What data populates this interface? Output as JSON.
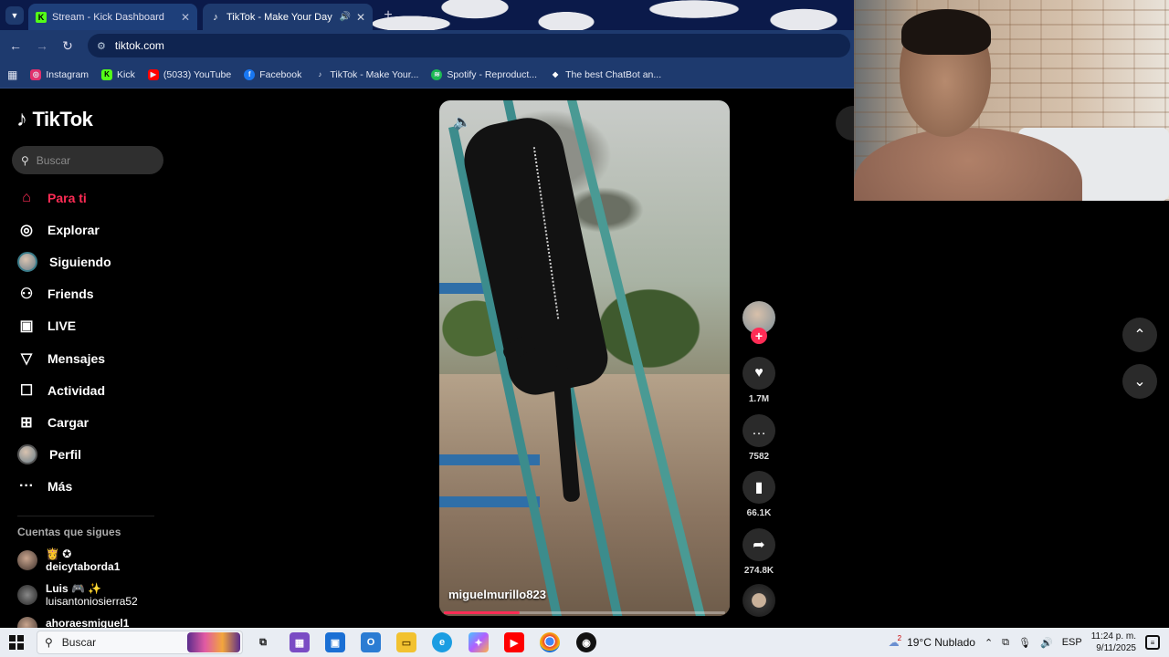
{
  "browser": {
    "tabs": [
      {
        "title": "Stream - Kick Dashboard",
        "favicon": "kick-icon"
      },
      {
        "title": "TikTok - Make Your Day",
        "favicon": "tiktok-icon",
        "audio": true
      }
    ],
    "url": "tiktok.com",
    "bookmarks": [
      {
        "label": "Instagram",
        "icon": "instagram-icon",
        "color": "#e1306c"
      },
      {
        "label": "Kick",
        "icon": "kick-icon",
        "color": "#53fc18"
      },
      {
        "label": "(5033) YouTube",
        "icon": "youtube-icon",
        "color": "#ff0000"
      },
      {
        "label": "Facebook",
        "icon": "facebook-icon",
        "color": "#1877f2"
      },
      {
        "label": "TikTok - Make Your...",
        "icon": "tiktok-icon",
        "color": "#000000"
      },
      {
        "label": "Spotify - Reproduct...",
        "icon": "spotify-icon",
        "color": "#1db954"
      },
      {
        "label": "The best ChatBot an...",
        "icon": "chatbot-icon",
        "color": "#ffffff"
      }
    ]
  },
  "tiktok": {
    "logo": "TikTok",
    "search_placeholder": "Buscar",
    "nav": [
      {
        "label": "Para ti",
        "icon": "home-icon",
        "active": true
      },
      {
        "label": "Explorar",
        "icon": "compass-icon"
      },
      {
        "label": "Siguiendo",
        "icon": "avatar"
      },
      {
        "label": "Friends",
        "icon": "friends-icon"
      },
      {
        "label": "LIVE",
        "icon": "live-icon"
      },
      {
        "label": "Mensajes",
        "icon": "messages-icon"
      },
      {
        "label": "Actividad",
        "icon": "activity-icon"
      },
      {
        "label": "Cargar",
        "icon": "upload-icon"
      },
      {
        "label": "Perfil",
        "icon": "avatar"
      },
      {
        "label": "Más",
        "icon": "more-icon"
      }
    ],
    "following_title": "Cuentas que sigues",
    "following": [
      {
        "name": "👸 ✪",
        "handle": "deicytaborda1"
      },
      {
        "name": "Luis 🎮 ✨",
        "handle": "luisantoniosierra52"
      },
      {
        "name": "",
        "handle": "ahoraesmiguel1"
      }
    ],
    "video": {
      "author": "miguelmurillo823",
      "progress": 0.27
    },
    "actions": {
      "likes": "1.7M",
      "comments": "7582",
      "saves": "66.1K",
      "shares": "274.8K"
    },
    "accent": "#fe2c55"
  },
  "taskbar": {
    "search": "Buscar",
    "weather": "19°C  Nublado",
    "weather_badge": "2",
    "lang": "ESP",
    "time": "11:24 p. m.",
    "date": "9/11/2025"
  }
}
